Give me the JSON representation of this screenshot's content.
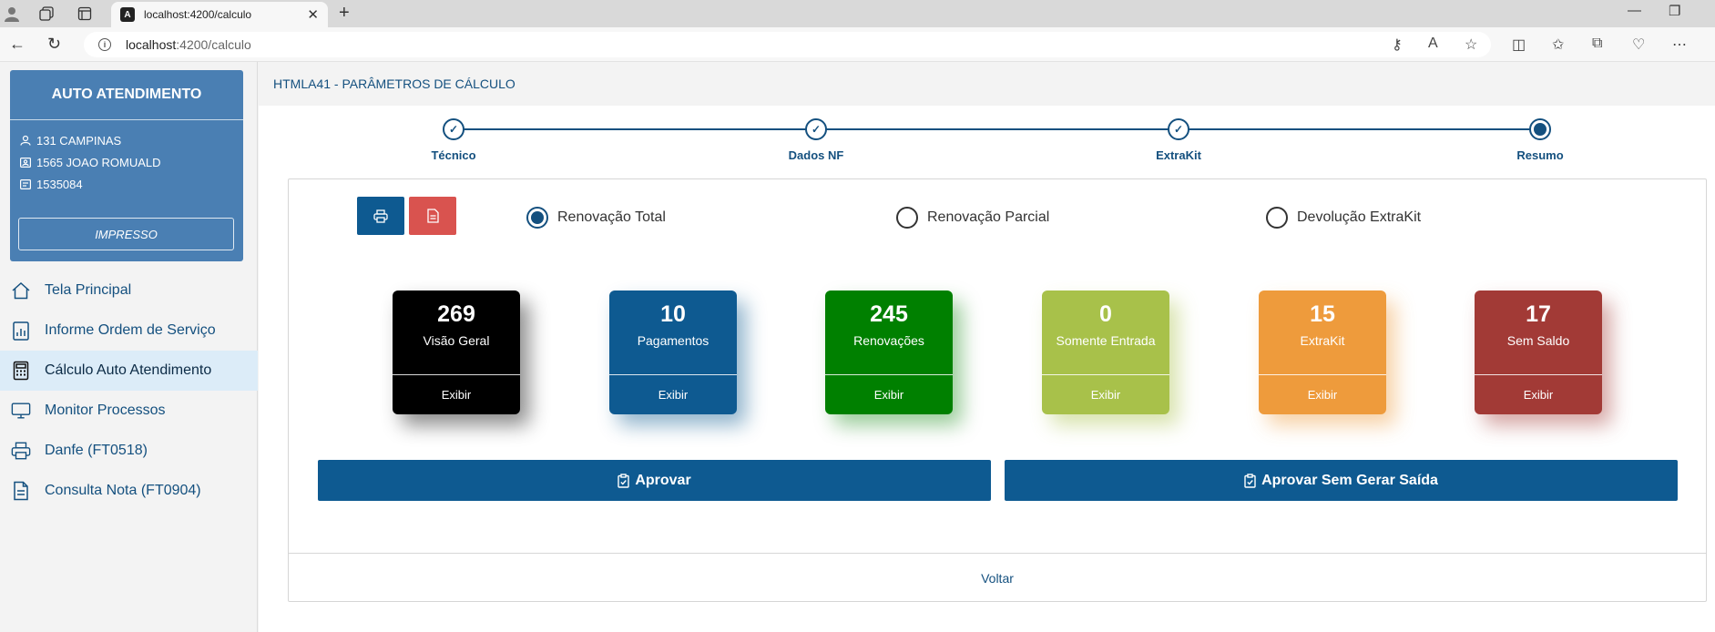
{
  "browser": {
    "tab_title": "localhost:4200/calculo",
    "url_host": "localhost",
    "url_path": ":4200/calculo"
  },
  "sidebar": {
    "title": "AUTO ATENDIMENTO",
    "info": [
      {
        "icon": "user-icon",
        "text": "131 CAMPINAS"
      },
      {
        "icon": "id-card-icon",
        "text": "1565 JOAO ROMUALD"
      },
      {
        "icon": "document-icon",
        "text": "1535084"
      }
    ],
    "button_label": "IMPRESSO",
    "menu": [
      {
        "icon": "home-icon",
        "label": "Tela Principal",
        "active": false
      },
      {
        "icon": "report-chart-icon",
        "label": "Informe Ordem de Serviço",
        "active": false
      },
      {
        "icon": "calculator-icon",
        "label": "Cálculo Auto Atendimento",
        "active": true
      },
      {
        "icon": "monitor-icon",
        "label": "Monitor Processos",
        "active": false
      },
      {
        "icon": "printer-icon",
        "label": "Danfe (FT0518)",
        "active": false
      },
      {
        "icon": "file-icon",
        "label": "Consulta Nota (FT0904)",
        "active": false
      }
    ]
  },
  "header": {
    "title": "HTMLA41 - PARÂMETROS DE CÁLCULO"
  },
  "stepper": {
    "steps": [
      {
        "label": "Técnico",
        "state": "done"
      },
      {
        "label": "Dados NF",
        "state": "done"
      },
      {
        "label": "ExtraKit",
        "state": "done"
      },
      {
        "label": "Resumo",
        "state": "current"
      }
    ]
  },
  "options": {
    "radios": [
      {
        "label": "Renovação Total",
        "checked": true
      },
      {
        "label": "Renovação Parcial",
        "checked": false
      },
      {
        "label": "Devolução ExtraKit",
        "checked": false
      }
    ]
  },
  "cards": [
    {
      "value": "269",
      "title": "Visão Geral",
      "action": "Exibir",
      "color": "#000000",
      "shadow": "rgba(0,0,0,0.45)"
    },
    {
      "value": "10",
      "title": "Pagamentos",
      "action": "Exibir",
      "color": "#0e5a91",
      "shadow": "rgba(14,90,145,0.45)"
    },
    {
      "value": "245",
      "title": "Renovações",
      "action": "Exibir",
      "color": "#008000",
      "shadow": "rgba(0,128,0,0.4)"
    },
    {
      "value": "0",
      "title": "Somente Entrada",
      "action": "Exibir",
      "color": "#a8c14a",
      "shadow": "rgba(168,193,74,0.45)"
    },
    {
      "value": "15",
      "title": "ExtraKit",
      "action": "Exibir",
      "color": "#ee9b3c",
      "shadow": "rgba(238,155,60,0.45)"
    },
    {
      "value": "17",
      "title": "Sem Saldo",
      "action": "Exibir",
      "color": "#a23a36",
      "shadow": "rgba(162,58,54,0.45)"
    }
  ],
  "actions": {
    "approve": "Aprovar",
    "approve_no_exit": "Aprovar Sem Gerar Saída",
    "back": "Voltar"
  },
  "colors": {
    "primary": "#0e5a91",
    "danger": "#d9534f",
    "sidebar_profile": "#4a7fb3",
    "active_menu": "#dcecf8"
  }
}
